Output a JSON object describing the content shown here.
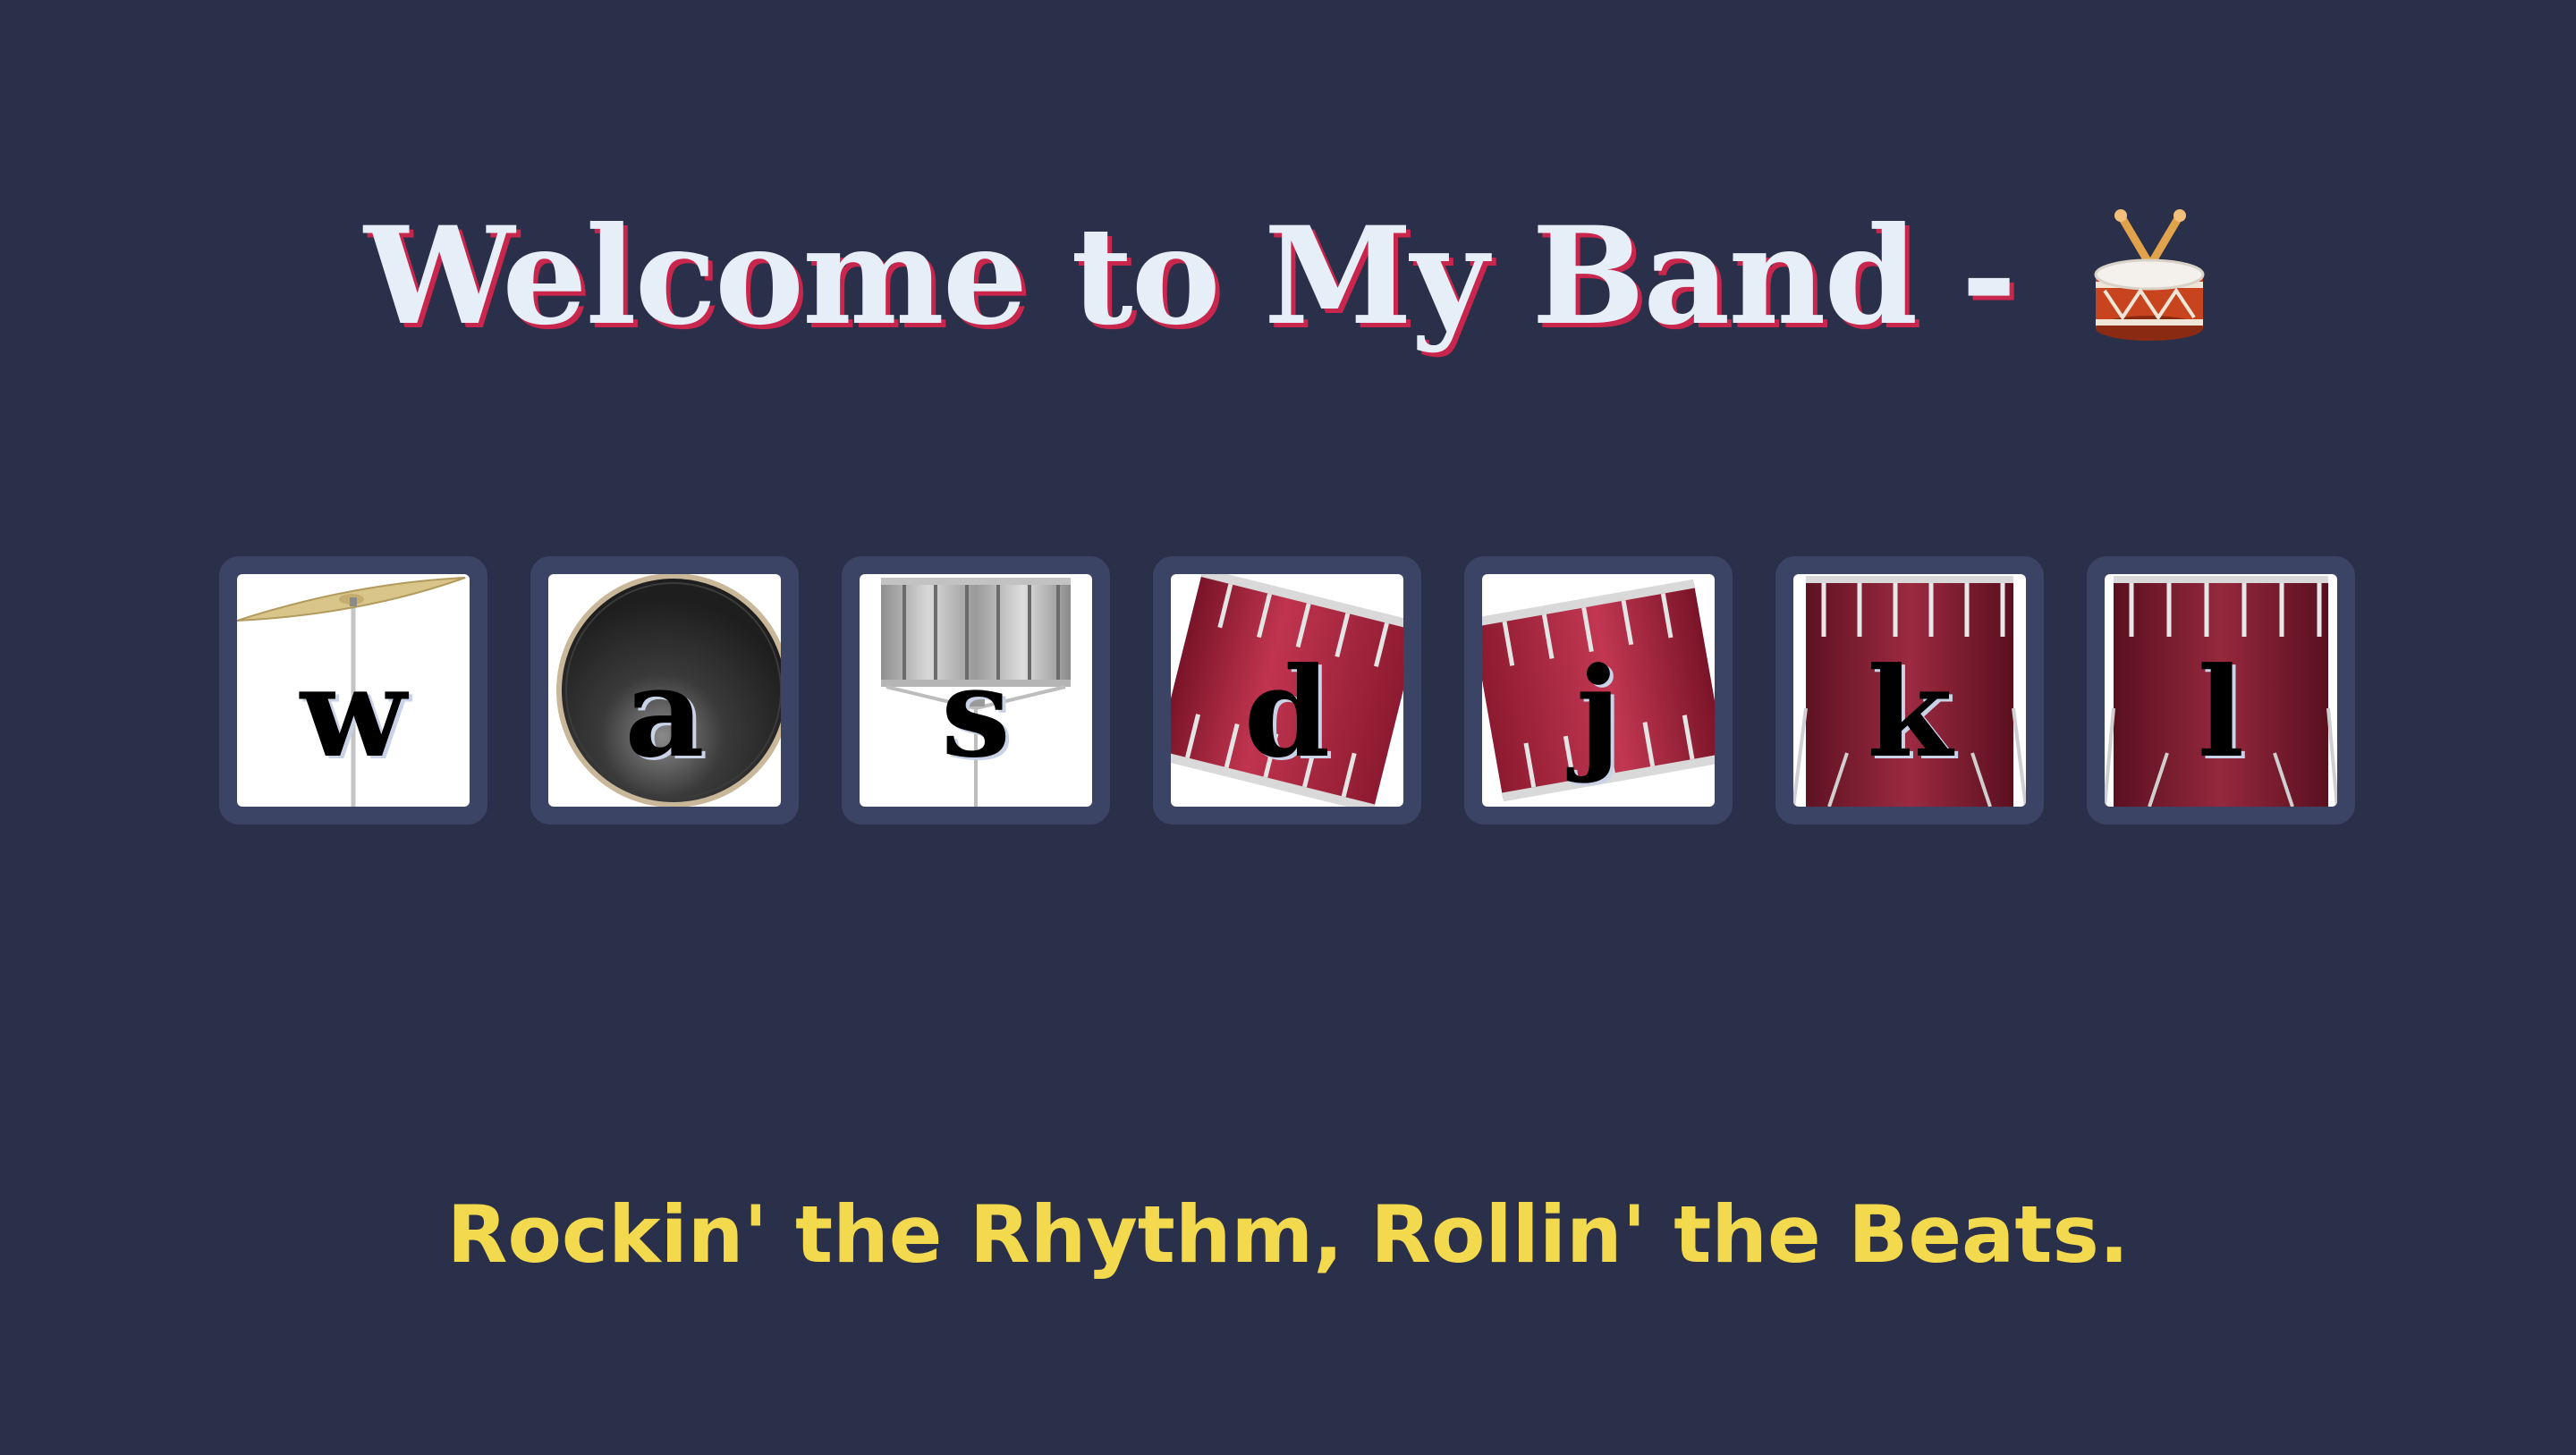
{
  "header": {
    "title": "Welcome to My Band - ",
    "title_icon": "drum-emoji-icon"
  },
  "drum_keys": [
    {
      "key": "w",
      "instrument_icon": "cymbal-icon"
    },
    {
      "key": "a",
      "instrument_icon": "bass-drum-icon"
    },
    {
      "key": "s",
      "instrument_icon": "snare-drum-icon"
    },
    {
      "key": "d",
      "instrument_icon": "tom-drum-icon"
    },
    {
      "key": "j",
      "instrument_icon": "tom-drum-icon"
    },
    {
      "key": "k",
      "instrument_icon": "floor-tom-icon"
    },
    {
      "key": "l",
      "instrument_icon": "floor-tom-icon"
    }
  ],
  "tagline": "Rockin' the Rhythm, Rollin' the Beats.",
  "colors": {
    "background": "#2a3049",
    "key_border": "#3c4465",
    "title": "#e6eef7",
    "title_shadow": "#c8264d",
    "tagline": "#f3d94e",
    "drum_red": "#a4223c"
  }
}
